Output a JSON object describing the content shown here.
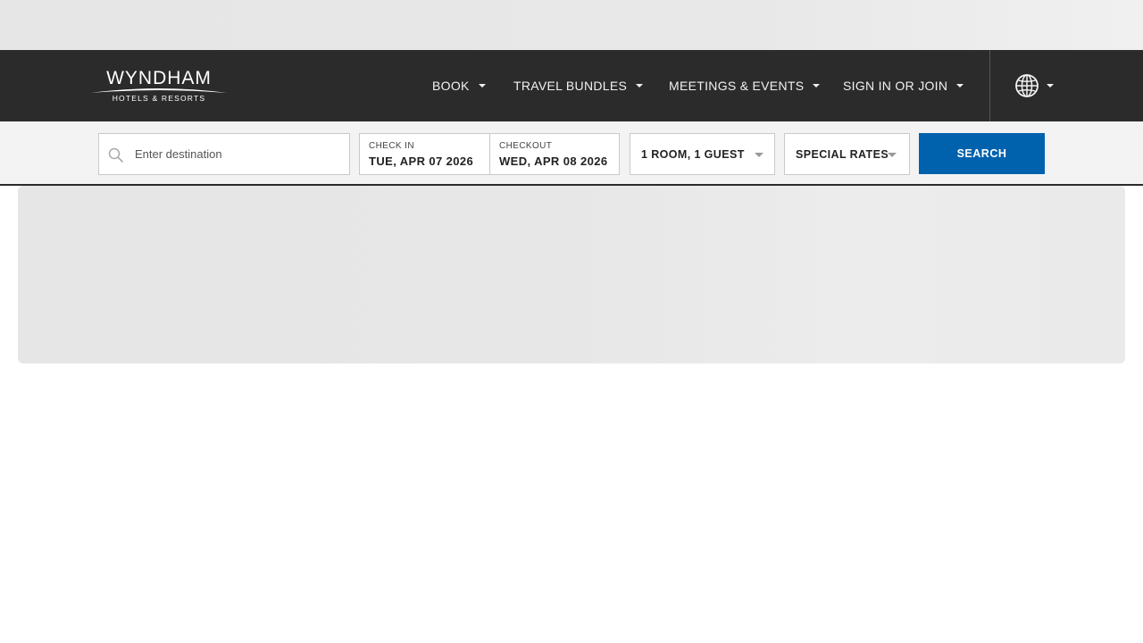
{
  "brand": {
    "name": "WYNDHAM",
    "tagline": "HOTELS & RESORTS"
  },
  "nav": {
    "items": [
      {
        "label": "BOOK"
      },
      {
        "label": "TRAVEL BUNDLES"
      },
      {
        "label": "MEETINGS & EVENTS"
      },
      {
        "label": "SIGN IN OR JOIN"
      }
    ],
    "language_icon": "globe-icon"
  },
  "search": {
    "destination_placeholder": "Enter destination",
    "destination_icon": "search-icon",
    "check_in": {
      "label": "CHECK IN",
      "value": "TUE, APR 07 2026"
    },
    "checkout": {
      "label": "CHECKOUT",
      "value": "WED, APR 08 2026"
    },
    "rooms_guests": "1 ROOM, 1 GUEST",
    "special_rates": "SPECIAL RATES",
    "button_label": "SEARCH"
  },
  "colors": {
    "nav_bg": "#2b2b2b",
    "search_button": "#0062ad",
    "search_bar_bg": "#f3f3f3"
  }
}
